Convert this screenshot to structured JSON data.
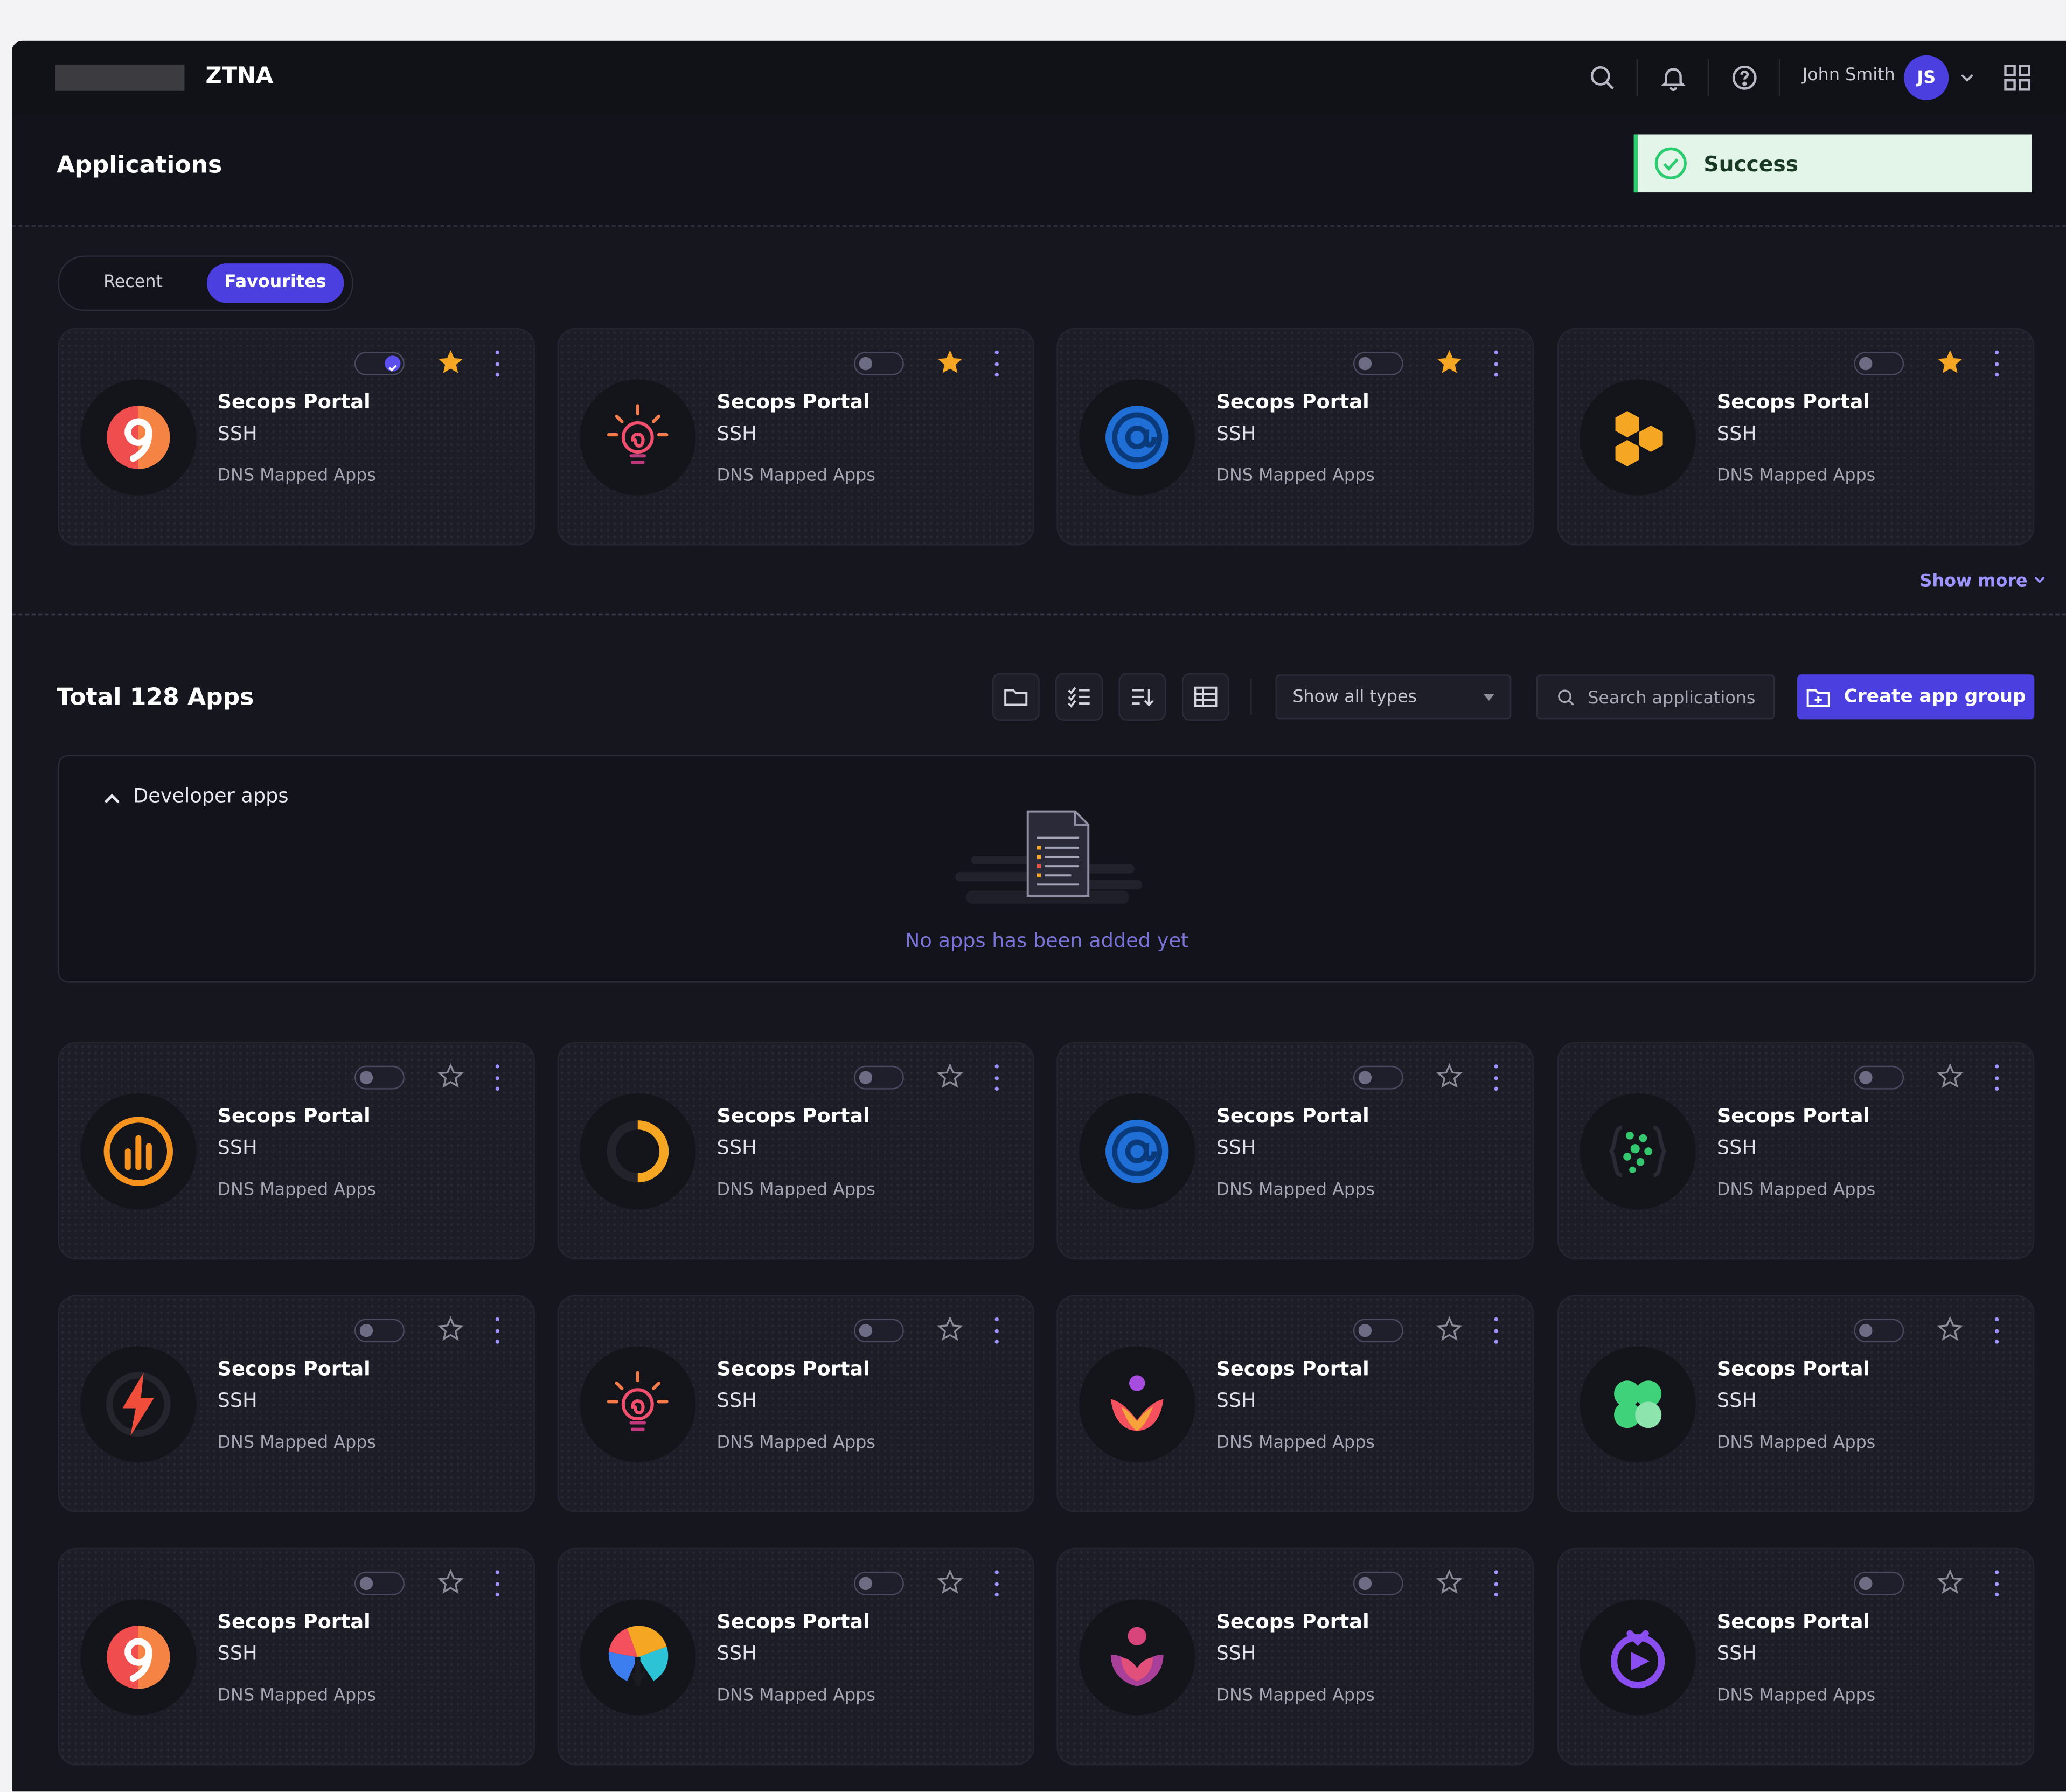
{
  "app": {
    "name": "ZTNA"
  },
  "topbar": {
    "user_name": "John Smith",
    "user_initials": "JS"
  },
  "header": {
    "title": "Applications"
  },
  "toast": {
    "message": "Success"
  },
  "tabs": {
    "recent": "Recent",
    "favourites": "Favourites",
    "active": "favourites"
  },
  "favourites": [
    {
      "title": "Secops Portal",
      "protocol": "SSH",
      "type": "DNS Mapped Apps",
      "logo": "nine-icon",
      "enabled": true,
      "favourite": true
    },
    {
      "title": "Secops Portal",
      "protocol": "SSH",
      "type": "DNS Mapped Apps",
      "logo": "lightbulb-icon",
      "enabled": false,
      "favourite": true
    },
    {
      "title": "Secops Portal",
      "protocol": "SSH",
      "type": "DNS Mapped Apps",
      "logo": "at-sign-icon",
      "enabled": false,
      "favourite": true
    },
    {
      "title": "Secops Portal",
      "protocol": "SSH",
      "type": "DNS Mapped Apps",
      "logo": "honeycomb-icon",
      "enabled": false,
      "favourite": true
    }
  ],
  "show_more": "Show more",
  "apps_section": {
    "total_label": "Total 128 Apps",
    "filter": {
      "selected": "Show all types"
    },
    "search": {
      "placeholder": "Search applications"
    },
    "create_button": "Create app group",
    "group": {
      "title": "Developer apps",
      "empty_text": "No apps has been added yet"
    }
  },
  "apps": [
    {
      "title": "Secops Portal",
      "protocol": "SSH",
      "type": "DNS Mapped Apps",
      "logo": "bar-chart-icon",
      "enabled": false,
      "favourite": false
    },
    {
      "title": "Secops Portal",
      "protocol": "SSH",
      "type": "DNS Mapped Apps",
      "logo": "crescent-ring-icon",
      "enabled": false,
      "favourite": false
    },
    {
      "title": "Secops Portal",
      "protocol": "SSH",
      "type": "DNS Mapped Apps",
      "logo": "at-sign-icon",
      "enabled": false,
      "favourite": false
    },
    {
      "title": "Secops Portal",
      "protocol": "SSH",
      "type": "DNS Mapped Apps",
      "logo": "dots-braces-icon",
      "enabled": false,
      "favourite": false
    },
    {
      "title": "Secops Portal",
      "protocol": "SSH",
      "type": "DNS Mapped Apps",
      "logo": "lightning-icon",
      "enabled": false,
      "favourite": false
    },
    {
      "title": "Secops Portal",
      "protocol": "SSH",
      "type": "DNS Mapped Apps",
      "logo": "lightbulb-icon",
      "enabled": false,
      "favourite": false
    },
    {
      "title": "Secops Portal",
      "protocol": "SSH",
      "type": "DNS Mapped Apps",
      "logo": "lotus-person-icon",
      "enabled": false,
      "favourite": false
    },
    {
      "title": "Secops Portal",
      "protocol": "SSH",
      "type": "DNS Mapped Apps",
      "logo": "clover-icon",
      "enabled": false,
      "favourite": false
    },
    {
      "title": "Secops Portal",
      "protocol": "SSH",
      "type": "DNS Mapped Apps",
      "logo": "nine-icon",
      "enabled": false,
      "favourite": false
    },
    {
      "title": "Secops Portal",
      "protocol": "SSH",
      "type": "DNS Mapped Apps",
      "logo": "propeller-icon",
      "enabled": false,
      "favourite": false
    },
    {
      "title": "Secops Portal",
      "protocol": "SSH",
      "type": "DNS Mapped Apps",
      "logo": "heart-person-icon",
      "enabled": false,
      "favourite": false
    },
    {
      "title": "Secops Portal",
      "protocol": "SSH",
      "type": "DNS Mapped Apps",
      "logo": "timer-play-icon",
      "enabled": false,
      "favourite": false
    }
  ],
  "colors": {
    "accent": "#4b3fe0",
    "background": "#16161f",
    "card": "#1d1d27",
    "success": "#2ecc71",
    "star": "#f5a623"
  }
}
